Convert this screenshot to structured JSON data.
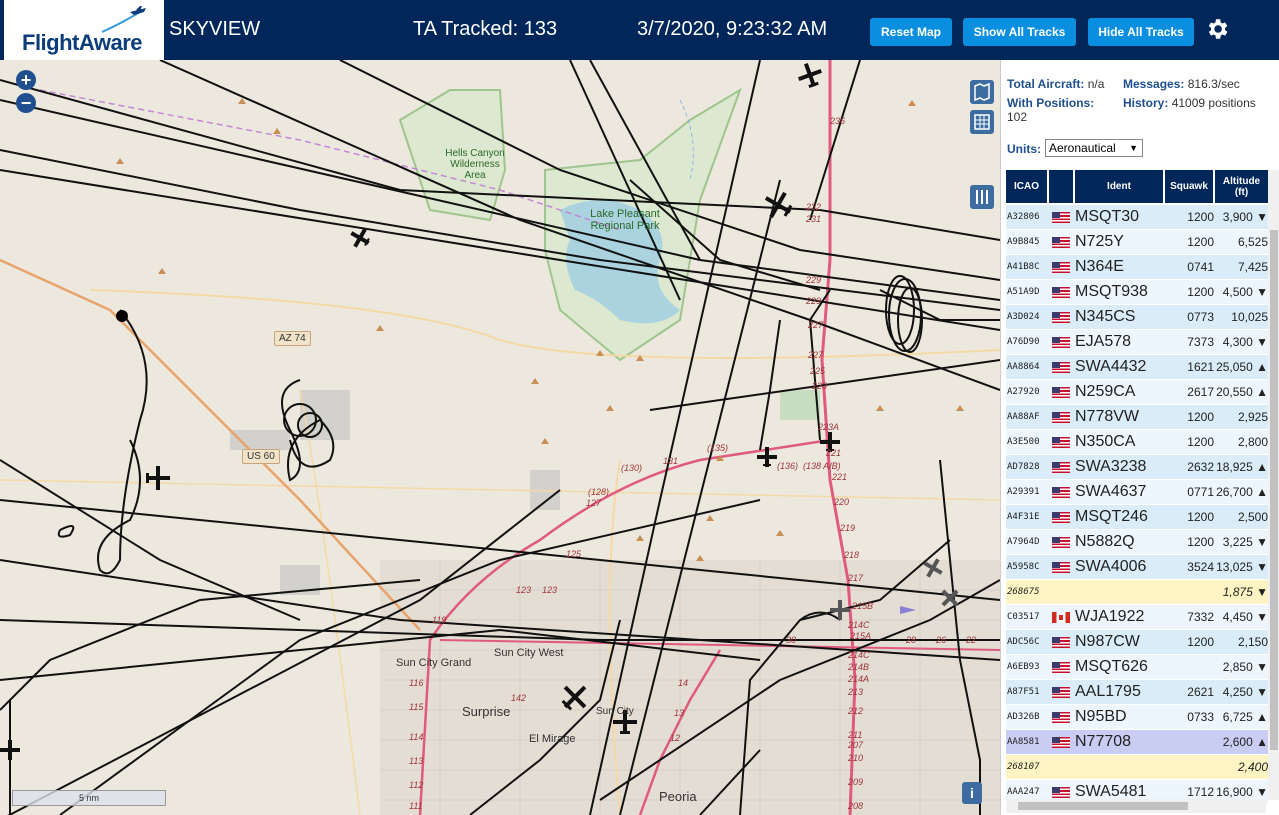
{
  "header": {
    "logo": "FlightAware",
    "site": "SKYVIEW",
    "tracked": "TA Tracked: 133",
    "datetime": "3/7/2020, 9:23:32 AM",
    "buttons": {
      "reset": "Reset Map",
      "show_all": "Show All Tracks",
      "hide_all": "Hide All Tracks"
    },
    "settings_icon": "gear-icon"
  },
  "map": {
    "zoom_in": "+",
    "zoom_out": "−",
    "scale": "5 nm",
    "info_icon": "i",
    "labels": {
      "park_hells": "Hells Canyon Wilderness Area",
      "park_lake": "Lake Pleasant Regional Park",
      "sun_city_grand": "Sun City Grand",
      "sun_city_west": "Sun City West",
      "surprise": "Surprise",
      "sun_city": "Sun City",
      "el_mirage": "El Mirage",
      "peoria": "Peoria"
    },
    "shields": {
      "az74": "AZ 74",
      "us60": "US 60"
    },
    "road_numbers": [
      "236",
      "232",
      "231",
      "229",
      "229",
      "227",
      "227",
      "225",
      "223",
      "223A",
      "221",
      "221",
      "220",
      "219",
      "218",
      "217",
      "215B",
      "215A",
      "214C",
      "214C",
      "214B",
      "214A",
      "213",
      "212",
      "211",
      "210",
      "209",
      "208",
      "207",
      "131",
      "(130)",
      "(135)",
      "(136)",
      "(138 A/B)",
      "(128)",
      "127",
      "125",
      "123",
      "123",
      "119",
      "116",
      "115",
      "114",
      "113",
      "112",
      "111",
      "142",
      "14",
      "13",
      "12",
      "30",
      "28",
      "26",
      "22"
    ],
    "colors": {
      "background": "#ece8de",
      "water": "#aad3df",
      "park": "#c8dcc0",
      "freeway": "#e05a7d",
      "track": "#111111"
    }
  },
  "panel": {
    "total_aircraft_label": "Total Aircraft:",
    "total_aircraft_value": "n/a",
    "messages_label": "Messages:",
    "messages_value": "816.3/sec",
    "with_positions_label": "With Positions:",
    "with_positions_value": "102",
    "history_label": "History:",
    "history_value": "41009 positions",
    "units_label": "Units:",
    "units_value": "Aeronautical",
    "columns": [
      "ICAO",
      "",
      "Ident",
      "Squawk",
      "Altitude (ft)"
    ],
    "rows": [
      {
        "icao": "A32806",
        "flag": "us",
        "ident": "MSQT30",
        "squawk": "1200",
        "alt": "3,900 ▼",
        "bg": "#d9ecf8"
      },
      {
        "icao": "A9B845",
        "flag": "us",
        "ident": "N725Y",
        "squawk": "1200",
        "alt": "6,525",
        "bg": "#edf6fc"
      },
      {
        "icao": "A41B8C",
        "flag": "us",
        "ident": "N364E",
        "squawk": "0741",
        "alt": "7,425",
        "bg": "#d9ecf8"
      },
      {
        "icao": "A51A9D",
        "flag": "us",
        "ident": "MSQT938",
        "squawk": "1200",
        "alt": "4,500 ▼",
        "bg": "#edf6fc"
      },
      {
        "icao": "A3D024",
        "flag": "us",
        "ident": "N345CS",
        "squawk": "0773",
        "alt": "10,025",
        "bg": "#d9ecf8"
      },
      {
        "icao": "A76D90",
        "flag": "us",
        "ident": "EJA578",
        "squawk": "7373",
        "alt": "4,300 ▼",
        "bg": "#edf6fc"
      },
      {
        "icao": "AA8864",
        "flag": "us",
        "ident": "SWA4432",
        "squawk": "1621",
        "alt": "25,050 ▲",
        "bg": "#d9ecf8"
      },
      {
        "icao": "A27920",
        "flag": "us",
        "ident": "N259CA",
        "squawk": "2617",
        "alt": "20,550 ▲",
        "bg": "#edf6fc"
      },
      {
        "icao": "AA88AF",
        "flag": "us",
        "ident": "N778VW",
        "squawk": "1200",
        "alt": "2,925",
        "bg": "#d9ecf8"
      },
      {
        "icao": "A3E500",
        "flag": "us",
        "ident": "N350CA",
        "squawk": "1200",
        "alt": "2,800",
        "bg": "#edf6fc"
      },
      {
        "icao": "AD7828",
        "flag": "us",
        "ident": "SWA3238",
        "squawk": "2632",
        "alt": "18,925 ▲",
        "bg": "#d9ecf8"
      },
      {
        "icao": "A29391",
        "flag": "us",
        "ident": "SWA4637",
        "squawk": "0771",
        "alt": "26,700 ▲",
        "bg": "#edf6fc"
      },
      {
        "icao": "A4F31E",
        "flag": "us",
        "ident": "MSQT246",
        "squawk": "1200",
        "alt": "2,500",
        "bg": "#d9ecf8"
      },
      {
        "icao": "A7964D",
        "flag": "us",
        "ident": "N5882Q",
        "squawk": "1200",
        "alt": "3,225 ▼",
        "bg": "#edf6fc"
      },
      {
        "icao": "A5958C",
        "flag": "us",
        "ident": "SWA4006",
        "squawk": "3524",
        "alt": "13,025 ▼",
        "bg": "#d9ecf8"
      },
      {
        "icao": "268675",
        "flag": "",
        "ident": "",
        "squawk": "",
        "alt": "1,875 ▼",
        "bg": "#fdf3c3",
        "italic": true
      },
      {
        "icao": "C03517",
        "flag": "ca",
        "ident": "WJA1922",
        "squawk": "7332",
        "alt": "4,450 ▼",
        "bg": "#edf6fc"
      },
      {
        "icao": "ADC56C",
        "flag": "us",
        "ident": "N987CW",
        "squawk": "1200",
        "alt": "2,150",
        "bg": "#d9ecf8"
      },
      {
        "icao": "A6EB93",
        "flag": "us",
        "ident": "MSQT626",
        "squawk": "",
        "alt": "2,850 ▼",
        "bg": "#edf6fc"
      },
      {
        "icao": "A87F51",
        "flag": "us",
        "ident": "AAL1795",
        "squawk": "2621",
        "alt": "4,250 ▼",
        "bg": "#d9ecf8"
      },
      {
        "icao": "AD326B",
        "flag": "us",
        "ident": "N95BD",
        "squawk": "0733",
        "alt": "6,725 ▲",
        "bg": "#edf6fc"
      },
      {
        "icao": "AA8581",
        "flag": "us",
        "ident": "N77708",
        "squawk": "",
        "alt": "2,600 ▲",
        "bg": "#c9cdf3"
      },
      {
        "icao": "268107",
        "flag": "",
        "ident": "",
        "squawk": "",
        "alt": "2,400",
        "bg": "#fdf3c3",
        "italic": true
      },
      {
        "icao": "AAA247",
        "flag": "us",
        "ident": "SWA5481",
        "squawk": "1712",
        "alt": "16,900 ▼",
        "bg": "#edf6fc"
      }
    ]
  }
}
